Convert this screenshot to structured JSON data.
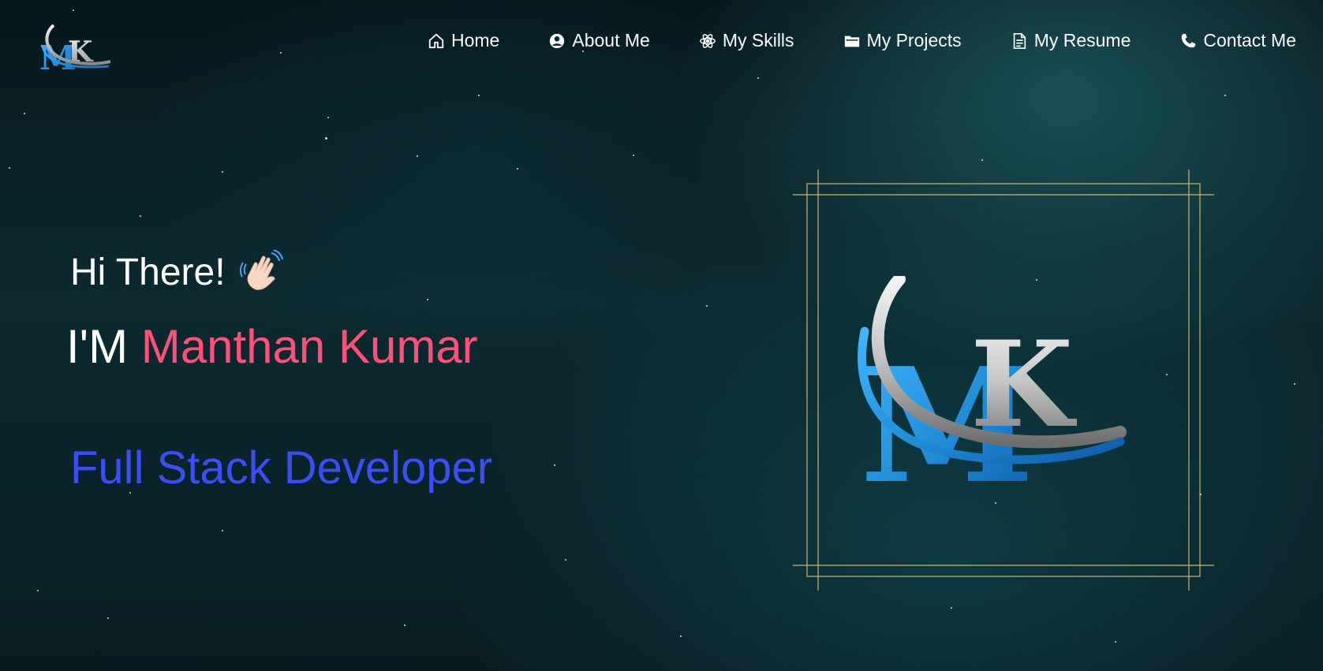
{
  "nav": {
    "logo_icon": "mk-logo-icon",
    "items": [
      {
        "label": "Home",
        "icon": "home-icon"
      },
      {
        "label": "About Me",
        "icon": "user-circle-icon"
      },
      {
        "label": "My Skills",
        "icon": "atom-icon"
      },
      {
        "label": "My Projects",
        "icon": "folder-icon"
      },
      {
        "label": "My Resume",
        "icon": "document-icon"
      },
      {
        "label": "Contact Me",
        "icon": "phone-icon"
      }
    ]
  },
  "hero": {
    "greeting": "Hi There!",
    "greeting_icon": "waving-hand-icon",
    "name_prefix": "I'M ",
    "name": "Manthan Kumar",
    "role": "Full Stack Developer",
    "logo_icon": "mk-logo-icon"
  },
  "colors": {
    "name_accent": "#ff4f7a",
    "role_accent": "#3b4ef5",
    "frame_line": "#c9b56a",
    "logo_blue": "#2a8fd6",
    "logo_silver": "#b8b8b8"
  }
}
